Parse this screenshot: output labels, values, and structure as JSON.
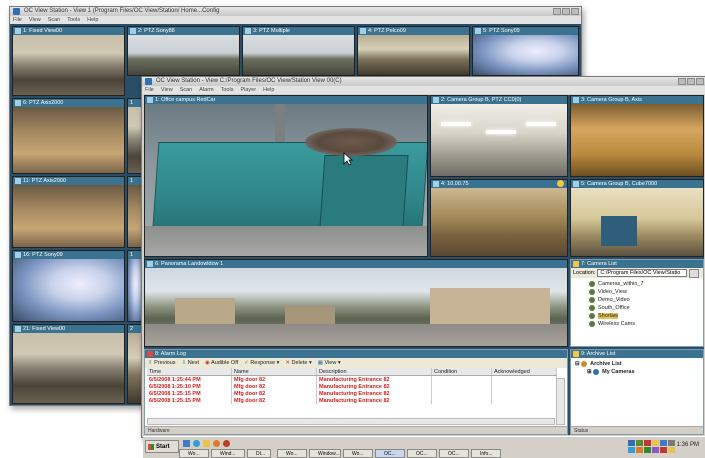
{
  "back_window": {
    "title": "OC View Station - View 1 (Program Files/OC View/Station/ Home...Config",
    "menu": [
      "File",
      "View",
      "Scan",
      "Tools",
      "Help"
    ],
    "cameras": [
      {
        "label": "1: Fixed View00"
      },
      {
        "label": "2: PTZ Sony88"
      },
      {
        "label": "3: PTZ Multiple"
      },
      {
        "label": "4: PTZ Pelco09"
      },
      {
        "label": "5: PTZ Sony09"
      },
      {
        "label": "6: PTZ Axis2000"
      },
      {
        "label": "1"
      },
      {
        "label": "11: PTZ Axis2000"
      },
      {
        "label": "1"
      },
      {
        "label": "16: PTZ Sony09"
      },
      {
        "label": "1"
      },
      {
        "label": "21: Fixed View00"
      },
      {
        "label": "2"
      }
    ]
  },
  "front_window": {
    "title": "OC View Station - View C:/Program Files/OC View/Station View 00(C)",
    "menu": [
      "File",
      "View",
      "Scan",
      "Alarm",
      "Tools",
      "Player",
      "Help"
    ],
    "main_cam": {
      "label": "1: Offce campus RedCar"
    },
    "cam2": {
      "label": "2: Camera Group B, PTZ CC0(0)"
    },
    "cam3": {
      "label": "3: Camera Group B, Axis"
    },
    "cam4": {
      "label": "4: 10.00.75"
    },
    "cam5": {
      "label": "5: Camera Group B, Cube7000"
    },
    "cam6": {
      "label": "6: Panorama Landowldow 1"
    },
    "camera_list": {
      "title": "7: Camera List",
      "location_label": "Location:",
      "location_value": "C:/Program Files/OC View/Statio",
      "items": [
        "Cameras_within_7",
        "Video_View",
        "Demo_Video",
        "South_Office",
        "Shorlaw",
        "Wireless Cams"
      ]
    },
    "alarm_log": {
      "title": "8: Alarm Log",
      "toolbar": [
        "Previous",
        "Next",
        "Audible Off",
        "Response",
        "Delete",
        "View"
      ],
      "columns": [
        "Time",
        "Name",
        "Description",
        "Condition",
        "Acknowledged"
      ],
      "rows": [
        [
          "6/5/2008 1:25:44 PM",
          "Mfg door 82",
          "Manufacturing Entrance 82",
          "",
          ""
        ],
        [
          "6/5/2008 1:25:10 PM",
          "Mfg door 82",
          "Manufacturing Entrance 82",
          "",
          ""
        ],
        [
          "6/5/2008 1:25:15 PM",
          "Mfg door 82",
          "Manufacturing Entrance 82",
          "",
          ""
        ],
        [
          "6/5/2008 1:25:15 PM",
          "Mfg door 82",
          "Manufacturing Entrance 82",
          "",
          ""
        ]
      ],
      "status": "Hardware"
    },
    "archive_list": {
      "title": "9: Archive List",
      "items": [
        "Archive List",
        "My Cameras"
      ],
      "status": "Status"
    }
  },
  "taskbar": {
    "start_label": "Start",
    "tasks": [
      "Wo...",
      "Wind...",
      "DI...",
      "Wo...",
      "Window...",
      "Wo...",
      "OC...",
      "OC...",
      "OC...",
      "Info..."
    ],
    "clock": "1:36 PM"
  }
}
